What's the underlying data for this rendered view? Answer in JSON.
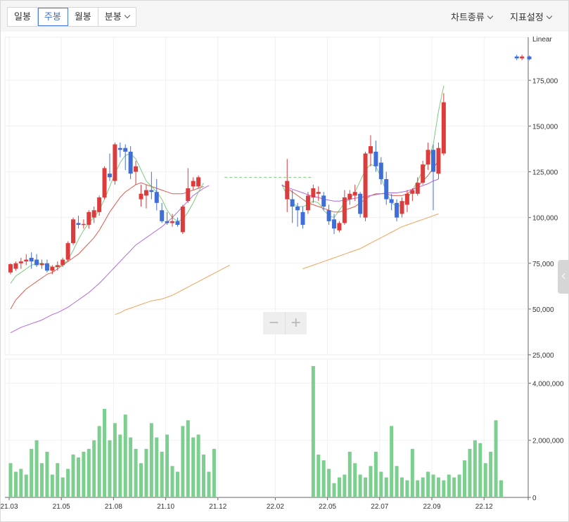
{
  "toolbar": {
    "tabs": [
      {
        "label": "일봉",
        "active": false
      },
      {
        "label": "주봉",
        "active": true
      },
      {
        "label": "월봉",
        "active": false
      },
      {
        "label": "분봉",
        "active": false
      }
    ],
    "chart_type_label": "차트종류",
    "indicator_label": "지표설정"
  },
  "zoom": {
    "minus": "−",
    "plus": "+"
  },
  "chart_data": {
    "type": "candlestick",
    "scale_label": "Linear",
    "y_ticks": [
      25000,
      50000,
      75000,
      100000,
      125000,
      150000,
      175000
    ],
    "y_tick_labels": [
      "25,000",
      "50,000",
      "75,000",
      "100,000",
      "125,000",
      "150,000",
      "175,000"
    ],
    "ylim": [
      25000,
      197000
    ],
    "x_tick_labels": [
      "21.03",
      "21.05",
      "21.08",
      "21.10",
      "21.12",
      "22.02",
      "22.05",
      "22.07",
      "22.09",
      "22.12"
    ],
    "x_tick_index": [
      0,
      10,
      20,
      30,
      40,
      51,
      61,
      71,
      81,
      91
    ],
    "volume_ticks": [
      0,
      2000000,
      4000000
    ],
    "volume_tick_labels": [
      "0",
      "2,000,000",
      "4,000,000"
    ],
    "volume_max": 4600000,
    "colors": {
      "up": "#dc3c3c",
      "down": "#3f6ed8",
      "ma5": "#7fcb7f",
      "ma20": "#dd5b4f",
      "ma60": "#b06ae0",
      "ma120": "#efa55a",
      "volume": "#7ccf8e"
    },
    "candles": [
      {
        "o": 70000,
        "h": 75000,
        "l": 69000,
        "c": 74500
      },
      {
        "o": 72000,
        "h": 76000,
        "l": 71000,
        "c": 75000
      },
      {
        "o": 75000,
        "h": 78000,
        "l": 72000,
        "c": 76000
      },
      {
        "o": 76000,
        "h": 80000,
        "l": 74000,
        "c": 77000
      },
      {
        "o": 78000,
        "h": 81000,
        "l": 72000,
        "c": 76000
      },
      {
        "o": 77000,
        "h": 80000,
        "l": 73000,
        "c": 74000
      },
      {
        "o": 74000,
        "h": 77000,
        "l": 72000,
        "c": 75000
      },
      {
        "o": 75000,
        "h": 77000,
        "l": 70000,
        "c": 71000
      },
      {
        "o": 71000,
        "h": 74000,
        "l": 69000,
        "c": 73000
      },
      {
        "o": 73000,
        "h": 76000,
        "l": 71000,
        "c": 74000
      },
      {
        "o": 74000,
        "h": 78000,
        "l": 73000,
        "c": 77000
      },
      {
        "o": 77000,
        "h": 87000,
        "l": 76000,
        "c": 86000
      },
      {
        "o": 86000,
        "h": 100000,
        "l": 85000,
        "c": 99000
      },
      {
        "o": 97000,
        "h": 101000,
        "l": 94000,
        "c": 96000
      },
      {
        "o": 96000,
        "h": 99000,
        "l": 94000,
        "c": 96500
      },
      {
        "o": 96000,
        "h": 104000,
        "l": 94000,
        "c": 103000
      },
      {
        "o": 100000,
        "h": 106000,
        "l": 97000,
        "c": 104000
      },
      {
        "o": 103000,
        "h": 112000,
        "l": 101000,
        "c": 111000
      },
      {
        "o": 111000,
        "h": 128000,
        "l": 110000,
        "c": 127000
      },
      {
        "o": 124000,
        "h": 135000,
        "l": 120000,
        "c": 122000
      },
      {
        "o": 120000,
        "h": 141000,
        "l": 118000,
        "c": 140000
      },
      {
        "o": 138000,
        "h": 141000,
        "l": 133000,
        "c": 137000
      },
      {
        "o": 138000,
        "h": 140000,
        "l": 126000,
        "c": 136000
      },
      {
        "o": 136000,
        "h": 139000,
        "l": 121000,
        "c": 124000
      },
      {
        "o": 125000,
        "h": 131000,
        "l": 118000,
        "c": 128000
      },
      {
        "o": 110000,
        "h": 118000,
        "l": 106000,
        "c": 113000
      },
      {
        "o": 112000,
        "h": 118000,
        "l": 105000,
        "c": 115000
      },
      {
        "o": 115000,
        "h": 125000,
        "l": 110000,
        "c": 114000
      },
      {
        "o": 114000,
        "h": 121000,
        "l": 104000,
        "c": 108000
      },
      {
        "o": 104000,
        "h": 108000,
        "l": 97000,
        "c": 98000
      },
      {
        "o": 98000,
        "h": 103000,
        "l": 96000,
        "c": 97000
      },
      {
        "o": 97000,
        "h": 102000,
        "l": 95000,
        "c": 98000
      },
      {
        "o": 98000,
        "h": 100000,
        "l": 95000,
        "c": 96000
      },
      {
        "o": 92000,
        "h": 107000,
        "l": 91000,
        "c": 106000
      },
      {
        "o": 109000,
        "h": 127000,
        "l": 108000,
        "c": 116000
      },
      {
        "o": 117000,
        "h": 122000,
        "l": 115000,
        "c": 120000
      },
      {
        "o": 117000,
        "h": 123000,
        "l": 116000,
        "c": 122000
      }
    ],
    "candles_2022": [
      {
        "i": 53,
        "o": 110000,
        "h": 132000,
        "l": 103000,
        "c": 120000
      },
      {
        "i": 54,
        "o": 110000,
        "h": 115000,
        "l": 97000,
        "c": 106000
      },
      {
        "i": 55,
        "o": 106000,
        "h": 108000,
        "l": 95000,
        "c": 104000
      },
      {
        "i": 56,
        "o": 103000,
        "h": 106000,
        "l": 94000,
        "c": 96000
      },
      {
        "i": 57,
        "o": 104000,
        "h": 114000,
        "l": 102000,
        "c": 112000
      },
      {
        "i": 58,
        "o": 111000,
        "h": 118000,
        "l": 108000,
        "c": 116000
      },
      {
        "i": 59,
        "o": 113000,
        "h": 117000,
        "l": 109000,
        "c": 114000
      },
      {
        "i": 60,
        "o": 112000,
        "h": 114000,
        "l": 104000,
        "c": 106000
      },
      {
        "i": 61,
        "o": 104000,
        "h": 107000,
        "l": 96000,
        "c": 98000
      },
      {
        "i": 62,
        "o": 99000,
        "h": 102000,
        "l": 91000,
        "c": 94000
      },
      {
        "i": 63,
        "o": 93000,
        "h": 98000,
        "l": 92000,
        "c": 97000
      },
      {
        "i": 64,
        "o": 97000,
        "h": 115000,
        "l": 96000,
        "c": 111000
      },
      {
        "i": 65,
        "o": 110000,
        "h": 115000,
        "l": 107000,
        "c": 113000
      },
      {
        "i": 66,
        "o": 112000,
        "h": 118000,
        "l": 109000,
        "c": 114000
      },
      {
        "i": 67,
        "o": 113000,
        "h": 114000,
        "l": 100000,
        "c": 102000
      },
      {
        "i": 68,
        "o": 100000,
        "h": 136000,
        "l": 98000,
        "c": 135000
      },
      {
        "i": 69,
        "o": 135000,
        "h": 145000,
        "l": 128000,
        "c": 139000
      },
      {
        "i": 70,
        "o": 136000,
        "h": 142000,
        "l": 125000,
        "c": 128000
      },
      {
        "i": 71,
        "o": 130000,
        "h": 133000,
        "l": 118000,
        "c": 121000
      },
      {
        "i": 72,
        "o": 121000,
        "h": 125000,
        "l": 107000,
        "c": 110000
      },
      {
        "i": 73,
        "o": 110000,
        "h": 113000,
        "l": 104000,
        "c": 108000
      },
      {
        "i": 74,
        "o": 108000,
        "h": 110000,
        "l": 98000,
        "c": 100000
      },
      {
        "i": 75,
        "o": 102000,
        "h": 111000,
        "l": 100000,
        "c": 109000
      },
      {
        "i": 76,
        "o": 107000,
        "h": 115000,
        "l": 103000,
        "c": 113000
      },
      {
        "i": 77,
        "o": 113000,
        "h": 116000,
        "l": 109000,
        "c": 115000
      },
      {
        "i": 78,
        "o": 113000,
        "h": 122000,
        "l": 112000,
        "c": 119000
      },
      {
        "i": 79,
        "o": 119000,
        "h": 131000,
        "l": 118000,
        "c": 129000
      },
      {
        "i": 80,
        "o": 129000,
        "h": 141000,
        "l": 126000,
        "c": 137000
      },
      {
        "i": 81,
        "o": 137000,
        "h": 140000,
        "l": 104000,
        "c": 125000
      },
      {
        "i": 82,
        "o": 124000,
        "h": 141000,
        "l": 121000,
        "c": 138000
      },
      {
        "i": 83,
        "o": 135000,
        "h": 168000,
        "l": 134000,
        "c": 163000
      }
    ],
    "last_candle": {
      "o": 188000,
      "h": 189000,
      "l": 186000,
      "c": 187000
    },
    "volumes": [
      1200000,
      900000,
      1000000,
      800000,
      1700000,
      2000000,
      1200000,
      1600000,
      800000,
      1200000,
      700000,
      1000000,
      1500000,
      1400000,
      1600000,
      1700000,
      2000000,
      2500000,
      3100000,
      2000000,
      2600000,
      2200000,
      2900000,
      2100000,
      1700000,
      1200000,
      1700000,
      2600000,
      2100000,
      1600000,
      2200000,
      1100000,
      900000,
      2500000,
      2700000,
      2100000,
      2200000,
      1500000,
      900000,
      1700000
    ],
    "volumes_2022": [
      4600000,
      1500000,
      1300000,
      1000000,
      500000,
      700000,
      800000,
      1600000,
      1200000,
      800000,
      700000,
      1100000,
      1600000,
      900000,
      700000,
      2500000,
      1100000,
      700000,
      600000,
      1700000,
      600000,
      700000,
      900000,
      800000,
      700000,
      600000,
      800000,
      700000,
      800000,
      1300000,
      1700000,
      2000000,
      1900000,
      1200000,
      1600000,
      2700000,
      600000
    ],
    "ma_series": {
      "ma5": [
        64000,
        68000,
        70000,
        72000,
        74000,
        75000,
        75000,
        74000,
        73000,
        73000,
        74000,
        77000,
        82000,
        88000,
        93000,
        97000,
        100000,
        104000,
        110000,
        117000,
        124000,
        130000,
        134000,
        135000,
        132000,
        126000,
        120000,
        117000,
        114000,
        110000,
        104000,
        100000,
        98000,
        99000,
        103000,
        108000,
        114000,
        119000
      ],
      "ma20": [
        50000,
        55000,
        58000,
        61000,
        63000,
        65000,
        67000,
        69000,
        70000,
        72000,
        74000,
        76000,
        78000,
        80000,
        83000,
        86000,
        89000,
        93000,
        98000,
        103000,
        107000,
        111000,
        114000,
        116000,
        118000,
        119000,
        118000,
        117000,
        116000,
        115000,
        114000,
        113000,
        113000,
        113000,
        114000,
        115000,
        116000,
        117000
      ],
      "ma60": [
        37000,
        38500,
        40000,
        41000,
        42000,
        43000,
        44000,
        45500,
        47000,
        48000,
        49500,
        51000,
        53000,
        55000,
        57000,
        59000,
        61500,
        64000,
        67000,
        70000,
        73000,
        76000,
        79000,
        82000,
        85000,
        87000,
        89000,
        91000,
        93000,
        95000,
        97500,
        100000,
        103000,
        106000,
        109000,
        112000,
        114000,
        116000,
        117500
      ],
      "ma120": [
        47000,
        48000,
        49500,
        50500,
        51500,
        52500,
        53500,
        54500,
        55000,
        55500,
        56500,
        57500,
        59000,
        60500,
        62000,
        63500,
        65000,
        66500,
        68000,
        69500,
        71000,
        72500,
        74000
      ]
    }
  }
}
